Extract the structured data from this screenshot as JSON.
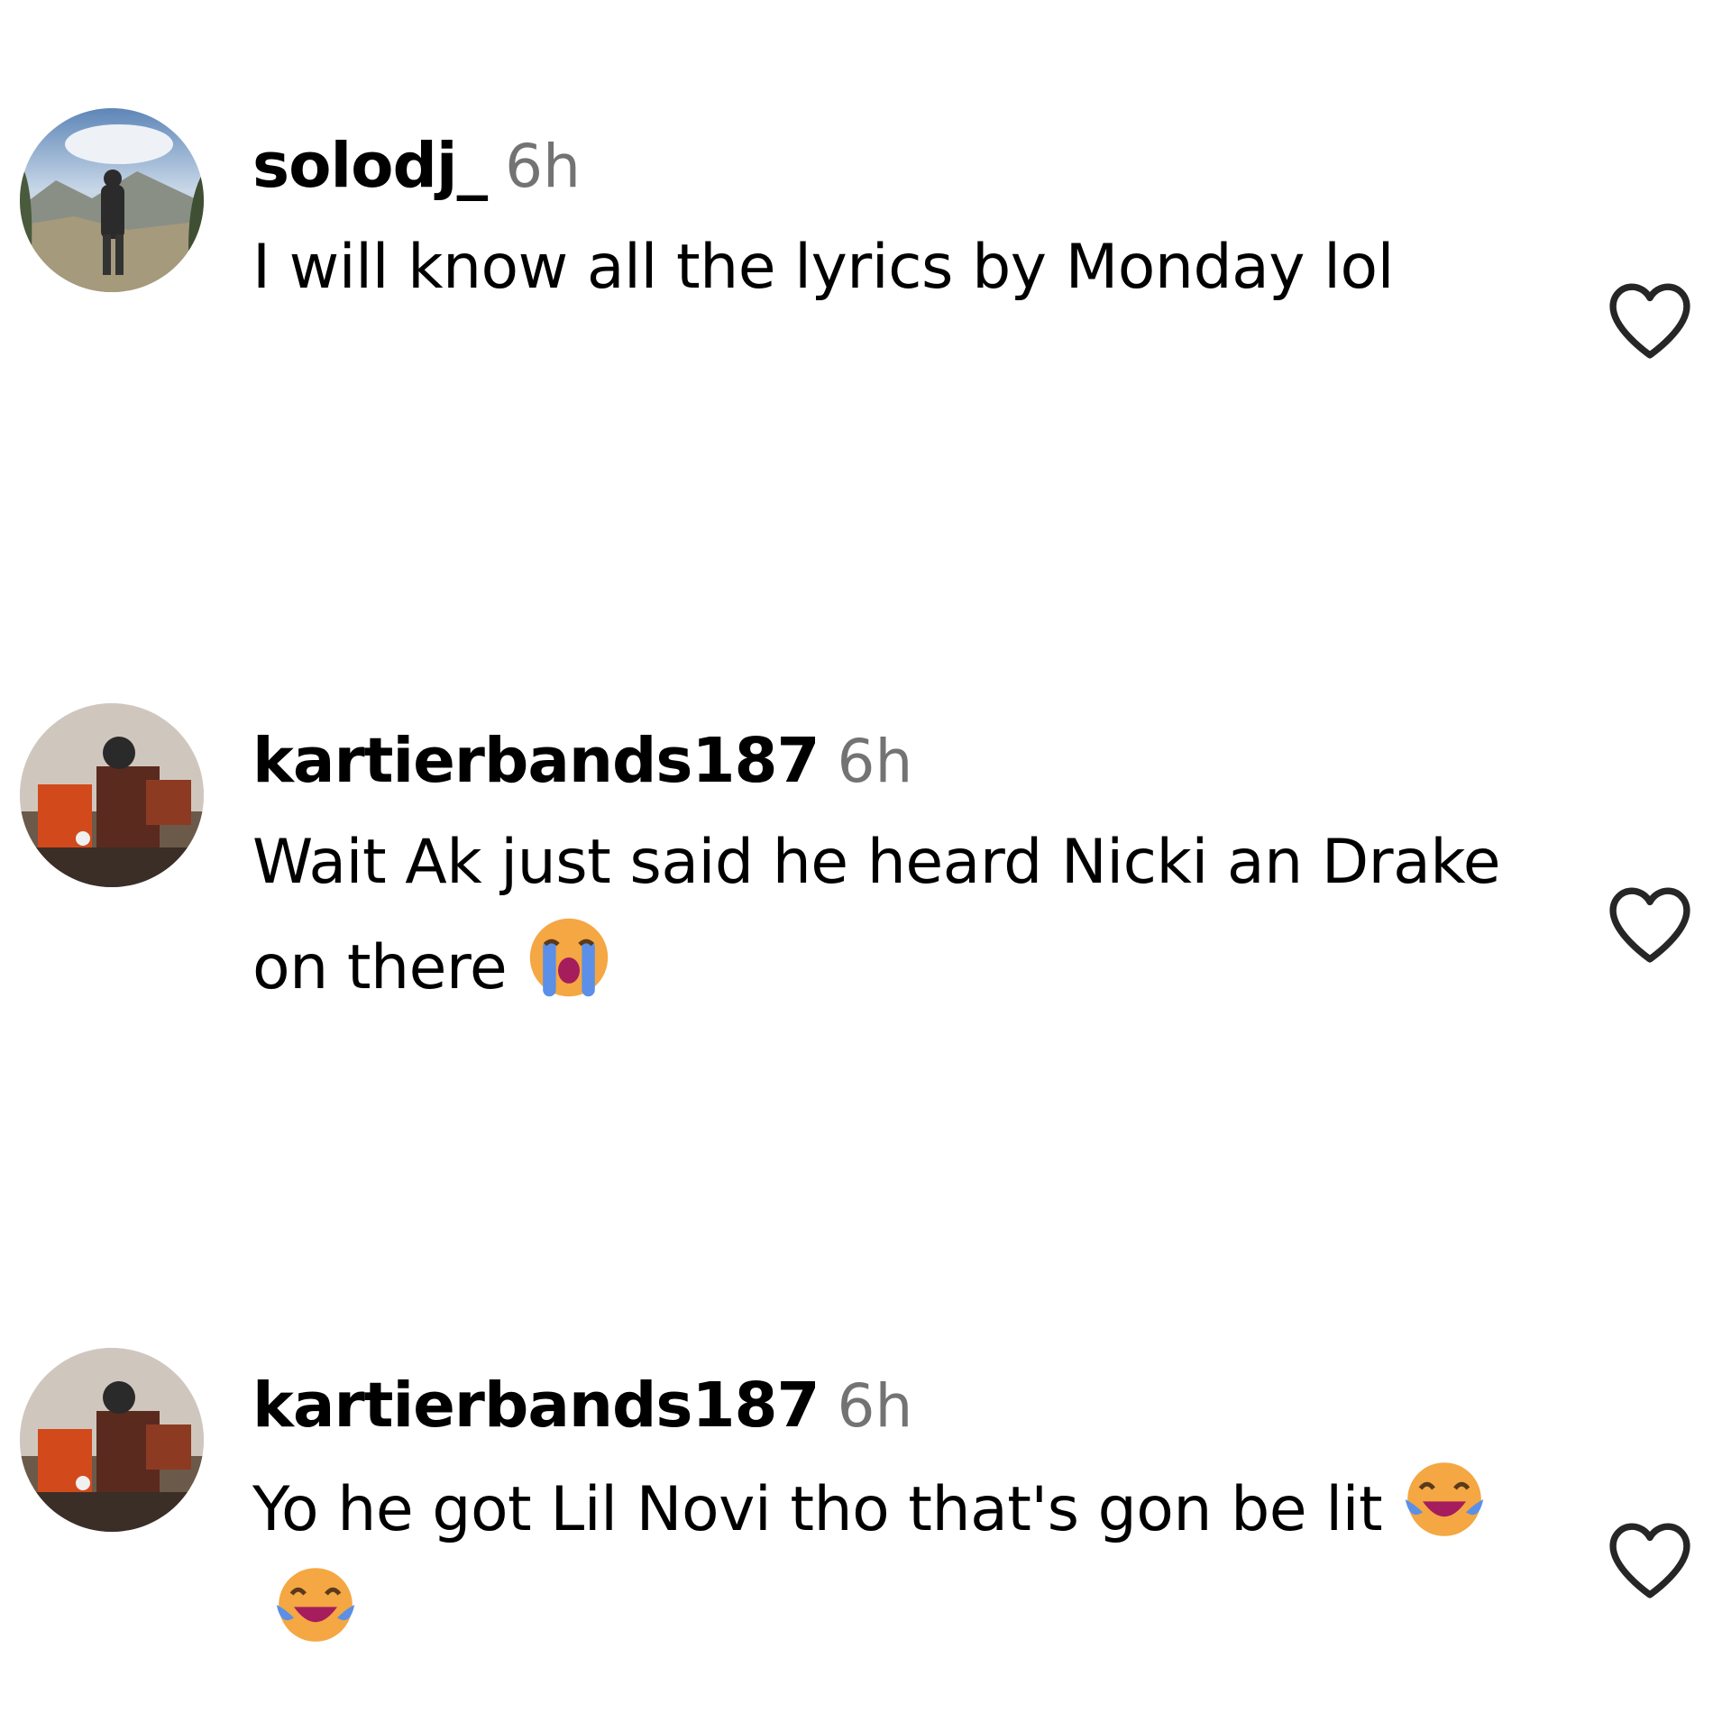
{
  "comments": [
    {
      "username": "solodj_",
      "time": "6h",
      "text": "I will know all the lyrics by Monday lol",
      "emojis": [],
      "avatar": "mountain-hiker-photo"
    },
    {
      "username": "kartierbands187",
      "time": "6h",
      "text": "Wait Ak just said he heard Nicki an Drake on there",
      "emojis": [
        "loudly-crying-face"
      ],
      "avatar": "outdoor-group-photo"
    },
    {
      "username": "kartierbands187",
      "time": "6h",
      "text": "Yo he got Lil Novi tho that's gon be lit",
      "emojis": [
        "face-with-tears-of-joy",
        "face-with-tears-of-joy"
      ],
      "avatar": "outdoor-group-photo"
    }
  ],
  "icons": {
    "like": "heart-outline-icon"
  },
  "colors": {
    "username": "#000000",
    "timestamp": "#737373",
    "heart_stroke": "#262626",
    "background": "#ffffff"
  }
}
